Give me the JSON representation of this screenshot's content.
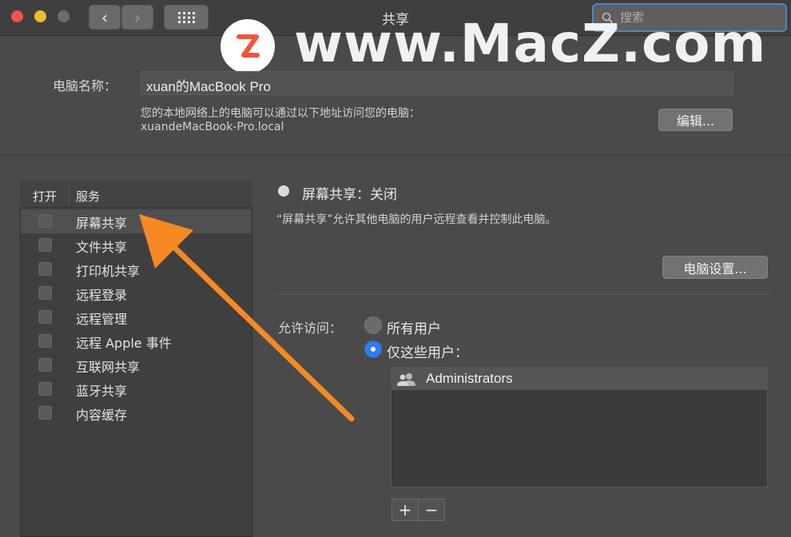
{
  "window": {
    "title": "共享"
  },
  "search": {
    "placeholder": "搜索"
  },
  "watermark": {
    "text": "www.MacZ.com",
    "logo_letter": "Z"
  },
  "computer_name": {
    "label": "电脑名称：",
    "value": "xuan的MacBook Pro",
    "info_line": "您的本地网络上的电脑可以通过以下地址访问您的电脑：",
    "address": "xuandeMacBook-Pro.local",
    "edit_button": "编辑..."
  },
  "services": {
    "col_on": "打开",
    "col_service": "服务",
    "items": [
      {
        "label": "屏幕共享",
        "checked": false,
        "selected": true
      },
      {
        "label": "文件共享",
        "checked": false
      },
      {
        "label": "打印机共享",
        "checked": false
      },
      {
        "label": "远程登录",
        "checked": false
      },
      {
        "label": "远程管理",
        "checked": false
      },
      {
        "label": "远程 Apple 事件",
        "checked": false
      },
      {
        "label": "互联网共享",
        "checked": false
      },
      {
        "label": "蓝牙共享",
        "checked": false
      },
      {
        "label": "内容缓存",
        "checked": false
      }
    ]
  },
  "detail": {
    "status": "屏幕共享：关闭",
    "description": "“屏幕共享”允许其他电脑的用户远程查看并控制此电脑。",
    "computer_settings_button": "电脑设置...",
    "allow_access_label": "允许访问：",
    "option_all_users": "所有用户",
    "option_only_these": "仅这些用户：",
    "selected_option": "only_these",
    "users": [
      "Administrators"
    ],
    "add_button": "+",
    "remove_button": "−"
  },
  "colors": {
    "accent": "#2f7bf5",
    "arrow": "#f58a24",
    "watermark_logo": "#f0553a"
  }
}
